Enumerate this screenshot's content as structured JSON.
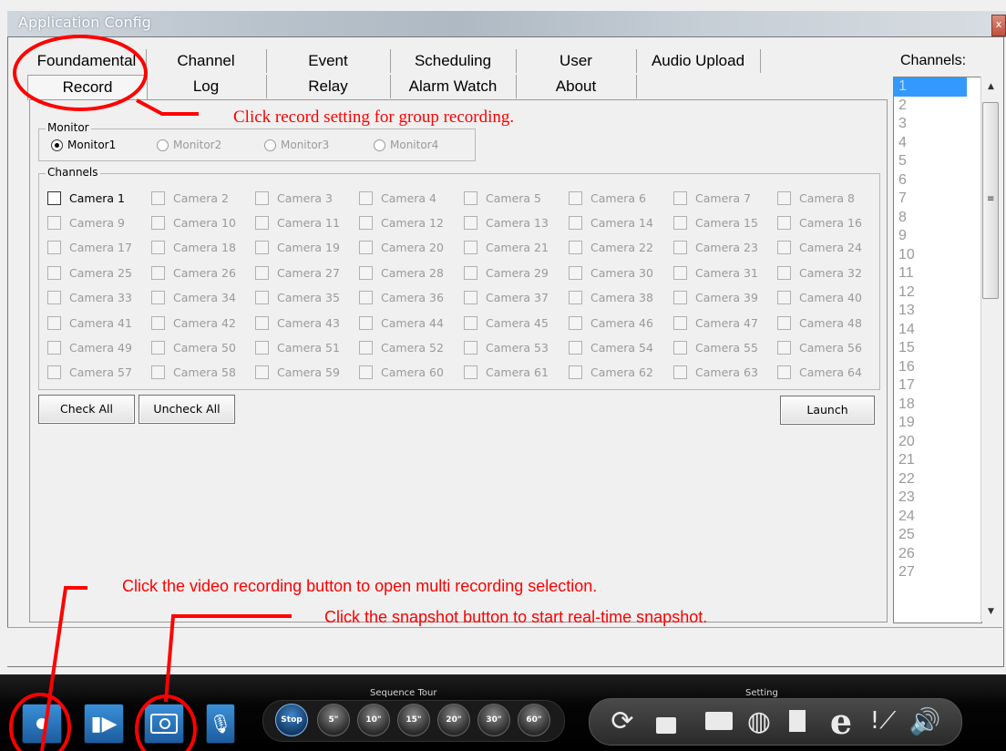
{
  "window": {
    "title": "Application Config",
    "close_label": "x"
  },
  "tabs_row1": [
    "Foundamental",
    "Channel",
    "Event",
    "Scheduling",
    "User",
    "Audio Upload"
  ],
  "tabs_row2": [
    "Record",
    "Log",
    "Relay",
    "Alarm Watch",
    "About"
  ],
  "active_tab": "Record",
  "monitor": {
    "legend": "Monitor",
    "options": [
      "Monitor1",
      "Monitor2",
      "Monitor3",
      "Monitor4"
    ],
    "selected": "Monitor1"
  },
  "channels_group": {
    "legend": "Channels",
    "cameras": [
      "Camera 1",
      "Camera 2",
      "Camera 3",
      "Camera 4",
      "Camera 5",
      "Camera 6",
      "Camera 7",
      "Camera 8",
      "Camera 9",
      "Camera 10",
      "Camera 11",
      "Camera 12",
      "Camera 13",
      "Camera 14",
      "Camera 15",
      "Camera 16",
      "Camera 17",
      "Camera 18",
      "Camera 19",
      "Camera 20",
      "Camera 21",
      "Camera 22",
      "Camera 23",
      "Camera 24",
      "Camera 25",
      "Camera 26",
      "Camera 27",
      "Camera 28",
      "Camera 29",
      "Camera 30",
      "Camera 31",
      "Camera 32",
      "Camera 33",
      "Camera 34",
      "Camera 35",
      "Camera 36",
      "Camera 37",
      "Camera 38",
      "Camera 39",
      "Camera 40",
      "Camera 41",
      "Camera 42",
      "Camera 43",
      "Camera 44",
      "Camera 45",
      "Camera 46",
      "Camera 47",
      "Camera 48",
      "Camera 49",
      "Camera 50",
      "Camera 51",
      "Camera 52",
      "Camera 53",
      "Camera 54",
      "Camera 55",
      "Camera 56",
      "Camera 57",
      "Camera 58",
      "Camera 59",
      "Camera 60",
      "Camera 61",
      "Camera 62",
      "Camera 63",
      "Camera 64"
    ],
    "enabled": [
      "Camera 1"
    ]
  },
  "buttons": {
    "check_all": "Check All",
    "uncheck_all": "Uncheck All",
    "launch": "Launch"
  },
  "channels_list": {
    "label": "Channels:",
    "items": [
      "1",
      "2",
      "3",
      "4",
      "5",
      "6",
      "7",
      "8",
      "9",
      "10",
      "11",
      "12",
      "13",
      "14",
      "15",
      "16",
      "17",
      "18",
      "19",
      "20",
      "21",
      "22",
      "23",
      "24",
      "25",
      "26",
      "27"
    ],
    "selected": "1"
  },
  "toolbar": {
    "sequence_tour_label": "Sequence Tour",
    "setting_label": "Setting",
    "tour_buttons": [
      "Stop",
      "5\"",
      "10\"",
      "15\"",
      "20\"",
      "30\"",
      "60\""
    ],
    "left_buttons": [
      "record-icon",
      "playback-icon",
      "snapshot-icon",
      "microphone-icon"
    ],
    "setting_icons": [
      "refresh-icon",
      "lock-icon",
      "folder-icon",
      "globe-icon",
      "document-icon",
      "ie-icon",
      "tools-icon",
      "speaker-icon"
    ]
  },
  "annotations": {
    "record_setting": "Click record setting for group recording.",
    "video_recording": "Click the video recording button to open multi recording selection.",
    "snapshot": "Click the snapshot button to start real-time snapshot.",
    "color": "#ff0000"
  }
}
